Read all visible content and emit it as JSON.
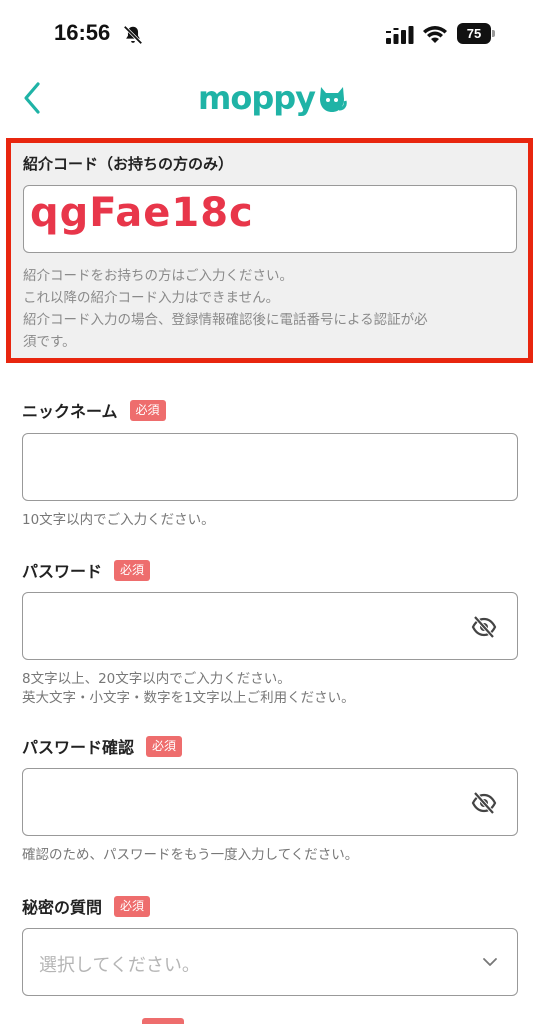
{
  "status_bar": {
    "time": "16:56",
    "battery": "75"
  },
  "nav": {
    "logo_text": "moppy"
  },
  "referral": {
    "label": "紹介コード（お持ちの方のみ）",
    "value": "qgFae18c",
    "help_lines": [
      "紹介コードをお持ちの方はご入力ください。",
      "これ以降の紹介コード入力はできません。",
      "紹介コード入力の場合、登録情報確認後に電話番号による認証が必",
      "須です。"
    ]
  },
  "required_label": "必須",
  "nickname": {
    "label": "ニックネーム",
    "value": "",
    "hint": "10文字以内でご入力ください。"
  },
  "password": {
    "label": "パスワード",
    "value": "",
    "hint_lines": [
      "8文字以上、20文字以内でご入力ください。",
      "英大文字・小文字・数字を1文字以上ご利用ください。"
    ]
  },
  "password_confirm": {
    "label": "パスワード確認",
    "value": "",
    "hint": "確認のため、パスワードをもう一度入力してください。"
  },
  "secret_question": {
    "label": "秘密の質問",
    "placeholder": "選択してください。"
  },
  "colors": {
    "accent": "#1fb3a6",
    "highlight_border": "#e8260f",
    "required_badge": "#ee6d6d",
    "referral_text": "#e8364a"
  },
  "icons": [
    "bell-slash-icon",
    "signal-icon",
    "wifi-icon",
    "battery-icon",
    "back-chevron-icon",
    "eye-slash-icon",
    "chevron-down-icon"
  ]
}
